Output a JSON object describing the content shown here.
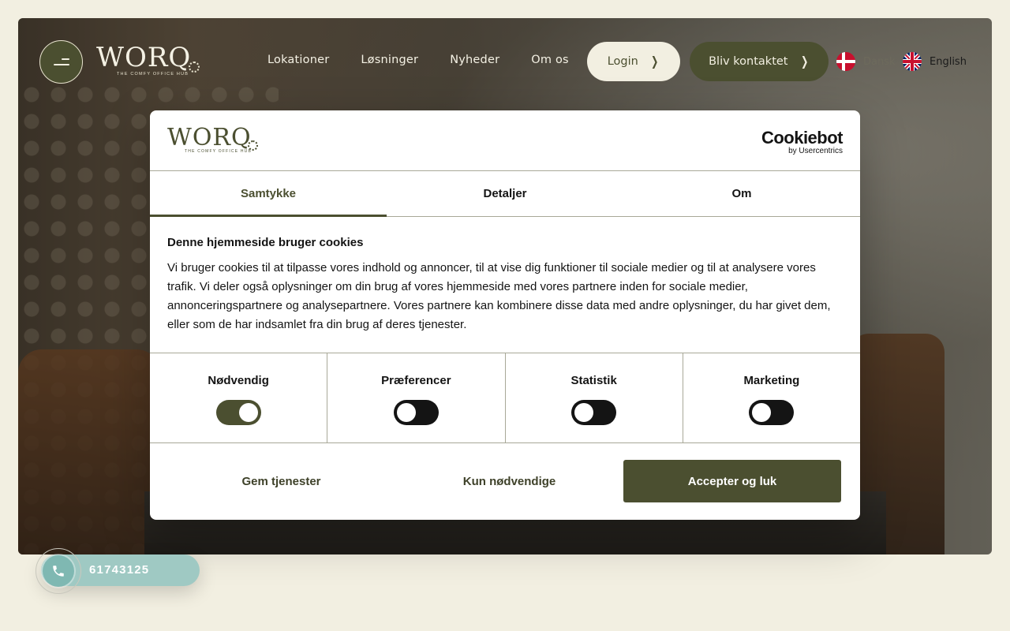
{
  "header": {
    "logo": {
      "wordmark": "WORQ",
      "tagline": "THE COMFY OFFICE HUB"
    },
    "nav": [
      {
        "label": "Lokationer"
      },
      {
        "label": "Løsninger"
      },
      {
        "label": "Nyheder"
      },
      {
        "label": "Om os"
      }
    ],
    "login_label": "Login",
    "contact_label": "Bliv kontaktet",
    "languages": [
      {
        "label": "Dansk",
        "icon": "flag-denmark-icon"
      },
      {
        "label": "English",
        "icon": "flag-uk-icon"
      }
    ]
  },
  "cookie_dialog": {
    "logo": {
      "wordmark": "WORQ",
      "tagline": "THE COMFY OFFICE HUB"
    },
    "provider": {
      "name": "Cookiebot",
      "sub": "by Usercentrics"
    },
    "tabs": [
      {
        "label": "Samtykke",
        "active": true
      },
      {
        "label": "Detaljer",
        "active": false
      },
      {
        "label": "Om",
        "active": false
      }
    ],
    "title": "Denne hjemmeside bruger cookies",
    "text": "Vi bruger cookies til at tilpasse vores indhold og annoncer, til at vise dig funktioner til sociale medier og til at analysere vores trafik. Vi deler også oplysninger om din brug af vores hjemmeside med vores partnere inden for sociale medier, annonceringspartnere og analysepartnere. Vores partnere kan kombinere disse data med andre oplysninger, du har givet dem, eller som de har indsamlet fra din brug af deres tjenester.",
    "toggles": [
      {
        "label": "Nødvendig",
        "checked": true
      },
      {
        "label": "Præferencer",
        "checked": false
      },
      {
        "label": "Statistik",
        "checked": false
      },
      {
        "label": "Marketing",
        "checked": false
      }
    ],
    "actions": {
      "save": "Gem tjenester",
      "necessary_only": "Kun nødvendige",
      "accept": "Accepter og luk"
    }
  },
  "phone": {
    "number": "61743125",
    "icon": "phone-icon"
  },
  "colors": {
    "brand_olive": "#4b4f30",
    "cream": "#f2efe1",
    "teal": "#9fc9c3"
  }
}
